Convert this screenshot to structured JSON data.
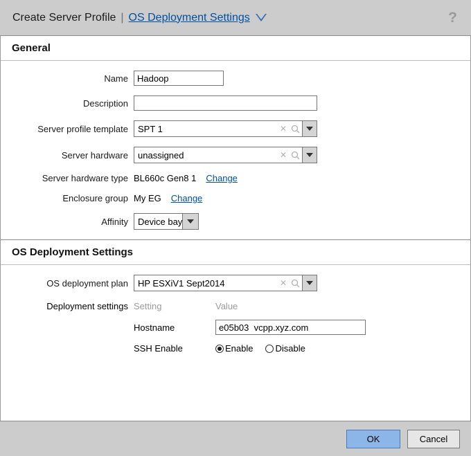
{
  "titlebar": {
    "breadcrumb_root": "Create Server Profile",
    "separator": "|",
    "breadcrumb_current": "OS Deployment Settings",
    "caret_icon": "chevron-down-icon",
    "help_label": "?",
    "link_color": "#0050a0",
    "bar_color": "#cccccc"
  },
  "general": {
    "section_title": "General",
    "fields": {
      "name": {
        "label": "Name",
        "value": "Hadoop",
        "placeholder": ""
      },
      "description": {
        "label": "Description",
        "value": "",
        "placeholder": ""
      },
      "server_profile_template": {
        "label": "Server profile template",
        "value": "SPT 1",
        "clear_icon": "x-clear-icon",
        "search_icon": "magnifier-icon",
        "arrow_icon": "caret-down-icon"
      },
      "server_hardware": {
        "label": "Server hardware",
        "value": "unassigned",
        "clear_icon": "x-clear-icon",
        "search_icon": "magnifier-icon",
        "arrow_icon": "caret-down-icon"
      },
      "server_hardware_type": {
        "label": "Server hardware type",
        "value": "BL660c Gen8 1",
        "change_label": "Change"
      },
      "enclosure_group": {
        "label": "Enclosure group",
        "value": "My EG",
        "change_label": "Change"
      },
      "affinity": {
        "label": "Affinity",
        "value": "Device bay",
        "arrow_icon": "caret-down-icon"
      }
    }
  },
  "os_deployment": {
    "section_title": "OS Deployment Settings",
    "os_deployment_plan": {
      "label": "OS deployment plan",
      "value": "HP ESXiV1 Sept2014",
      "clear_icon": "x-clear-icon",
      "search_icon": "magnifier-icon",
      "arrow_icon": "caret-down-icon"
    },
    "deployment_settings": {
      "label": "Deployment settings",
      "columns": [
        "Setting",
        "Value"
      ],
      "rows": [
        {
          "setting": "Hostname",
          "type": "text",
          "value": "e05b03  vcpp.xyz.com"
        },
        {
          "setting": "SSH Enable",
          "type": "radio",
          "options": [
            "Enable",
            "Disable"
          ],
          "selected": "Enable"
        }
      ]
    }
  },
  "footer": {
    "ok_label": "OK",
    "cancel_label": "Cancel",
    "ok_color": "#8cb6e8"
  }
}
